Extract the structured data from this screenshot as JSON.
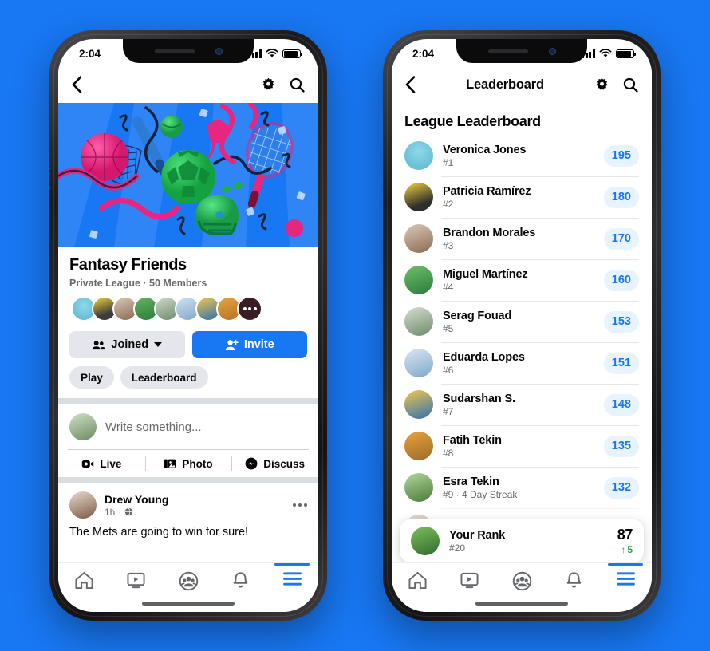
{
  "theme": {
    "brand_blue": "#1877F2",
    "pill_bg": "#E7F3FF",
    "grey_btn": "#E4E6EB",
    "text_primary": "#050505",
    "text_secondary": "#65676B",
    "green": "#31A24C"
  },
  "status_bar": {
    "time": "2:04",
    "signal_icon": "cellular-bars-icon",
    "wifi_icon": "wifi-icon",
    "battery_icon": "battery-icon"
  },
  "left_phone": {
    "nav": {
      "back_icon": "back-chevron-icon",
      "title": "",
      "settings_icon": "gear-icon",
      "search_icon": "search-icon"
    },
    "cover": {
      "alt": "sports-collage-cover"
    },
    "group": {
      "name": "Fantasy Friends",
      "meta": "Private League · 50 Members",
      "member_count": 9,
      "more_label": "•••"
    },
    "buttons": {
      "joined_label": "Joined",
      "joined_icon": "members-icon",
      "invite_label": "Invite",
      "invite_icon": "add-person-icon"
    },
    "chips": [
      "Play",
      "Leaderboard"
    ],
    "composer": {
      "placeholder": "Write something...",
      "actions": [
        {
          "label": "Live",
          "icon": "live-video-icon"
        },
        {
          "label": "Photo",
          "icon": "photo-icon"
        },
        {
          "label": "Discuss",
          "icon": "messenger-icon"
        }
      ]
    },
    "post": {
      "author": "Drew Young",
      "time": "1h",
      "privacy_icon": "globe-icon",
      "menu_icon": "more-options-icon",
      "text": "The Mets are going to win for sure!"
    }
  },
  "right_phone": {
    "nav": {
      "back_icon": "back-chevron-icon",
      "title": "Leaderboard",
      "settings_icon": "gear-icon",
      "search_icon": "search-icon"
    },
    "section_title": "League Leaderboard",
    "rows": [
      {
        "name": "Veronica Jones",
        "rank": "#1",
        "score": "195"
      },
      {
        "name": "Patricia Ramírez",
        "rank": "#2",
        "score": "180"
      },
      {
        "name": "Brandon Morales",
        "rank": "#3",
        "score": "170"
      },
      {
        "name": "Miguel Martínez",
        "rank": "#4",
        "score": "160"
      },
      {
        "name": "Serag Fouad",
        "rank": "#5",
        "score": "153"
      },
      {
        "name": "Eduarda Lopes",
        "rank": "#6",
        "score": "151"
      },
      {
        "name": "Sudarshan S.",
        "rank": "#7",
        "score": "148"
      },
      {
        "name": "Fatih Tekin",
        "rank": "#8",
        "score": "135"
      },
      {
        "name": "Esra Tekin",
        "rank": "#9 · 4 Day Streak",
        "score": "132"
      }
    ],
    "your_rank": {
      "label": "Your Rank",
      "rank": "#20",
      "score": "87",
      "delta": "5",
      "delta_arrow": "↑"
    }
  },
  "tabbar": {
    "items": [
      {
        "icon": "home-icon",
        "active": false
      },
      {
        "icon": "watch-icon",
        "active": false
      },
      {
        "icon": "groups-icon",
        "active": false
      },
      {
        "icon": "bell-icon",
        "active": false
      },
      {
        "icon": "menu-icon",
        "active": true
      }
    ]
  }
}
